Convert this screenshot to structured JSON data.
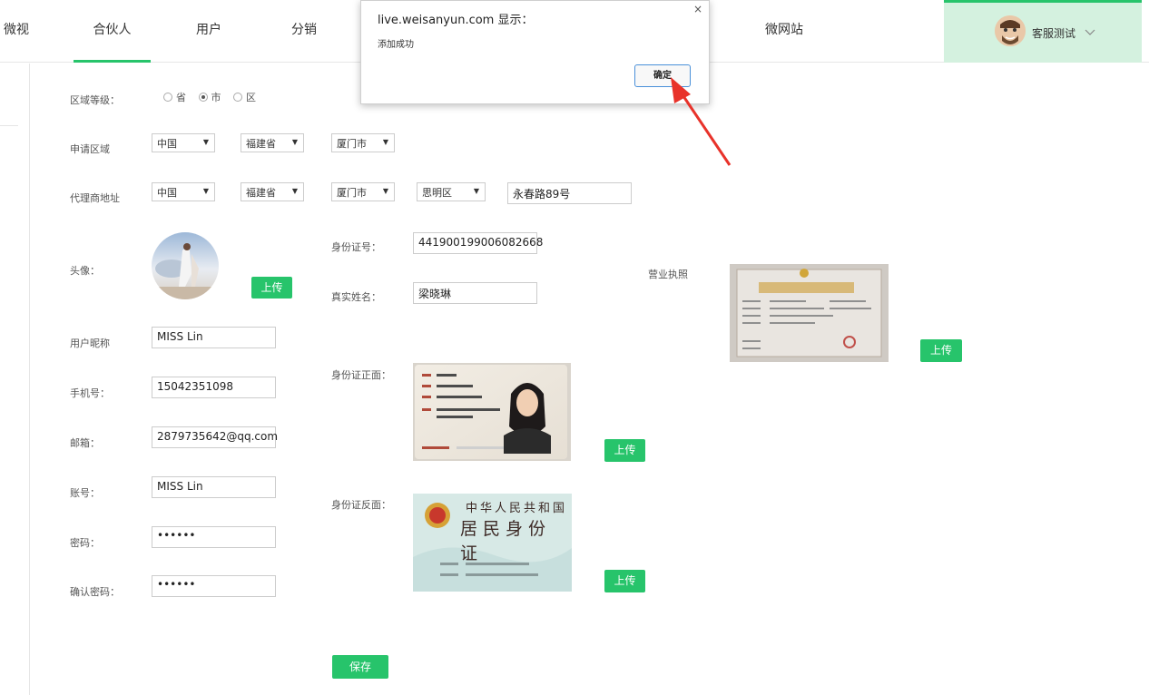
{
  "nav": {
    "items": [
      {
        "label": "微视"
      },
      {
        "label": "合伙人",
        "active": true
      },
      {
        "label": "用户"
      },
      {
        "label": "分销"
      },
      {
        "label": "微网站"
      }
    ],
    "user_name": "客服测试",
    "accent_color": "#27c46b"
  },
  "form": {
    "region_level": {
      "label": "区域等级：",
      "options": [
        "省",
        "市",
        "区"
      ],
      "selected": "市"
    },
    "apply_region": {
      "label": "申请区域",
      "country": "中国",
      "province": "福建省",
      "city": "厦门市"
    },
    "agent_address": {
      "label": "代理商地址",
      "country": "中国",
      "province": "福建省",
      "city": "厦门市",
      "district": "思明区",
      "street": "永春路89号"
    },
    "avatar": {
      "label": "头像：",
      "upload_label": "上传"
    },
    "id_number": {
      "label": "身份证号：",
      "value": "441900199006082668"
    },
    "real_name": {
      "label": "真实姓名：",
      "value": "梁晓琳"
    },
    "business_license": {
      "label": "营业执照",
      "upload_label": "上传"
    },
    "nickname": {
      "label": "用户昵称",
      "value": "MISS Lin"
    },
    "phone": {
      "label": "手机号：",
      "value": "15042351098"
    },
    "email": {
      "label": "邮箱：",
      "value": "2879735642@qq.com"
    },
    "account": {
      "label": "账号：",
      "value": "MISS Lin"
    },
    "password": {
      "label": "密码：",
      "value": "••••••"
    },
    "confirm_password": {
      "label": "确认密码：",
      "value": "••••••"
    },
    "id_front": {
      "label": "身份证正面：",
      "upload_label": "上传"
    },
    "id_back": {
      "label": "身份证反面：",
      "upload_label": "上传",
      "line1": "中华人民共和国",
      "line2": "居民身份证"
    },
    "save_label": "保存"
  },
  "dialog": {
    "title": "live.weisanyun.com 显示：",
    "message": "添加成功",
    "ok_label": "确定",
    "close_glyph": "×"
  }
}
